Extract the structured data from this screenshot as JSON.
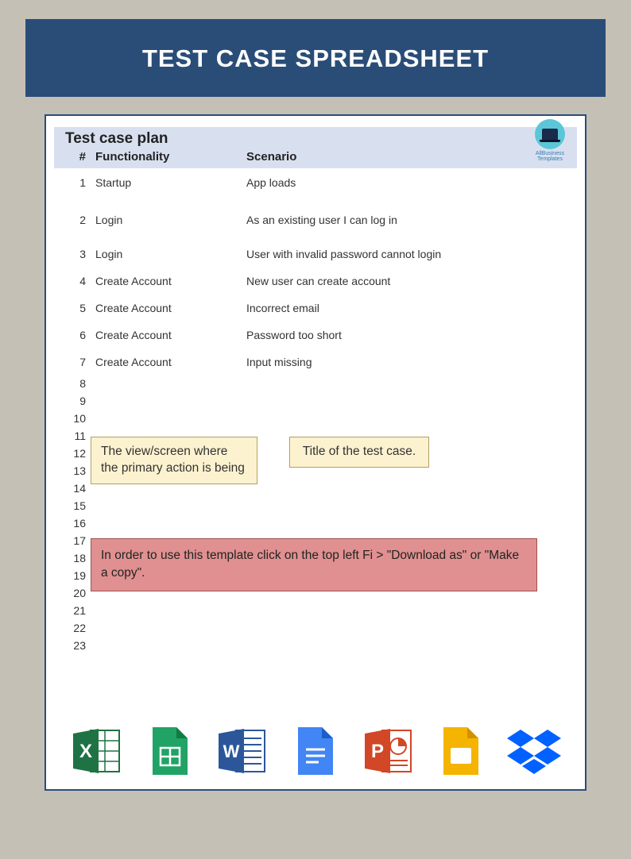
{
  "header": {
    "title": "TEST CASE SPREADSHEET"
  },
  "plan": {
    "title": "Test case plan",
    "columns": {
      "num": "#",
      "functionality": "Functionality",
      "scenario": "Scenario"
    },
    "rows": [
      {
        "num": "1",
        "functionality": "Startup",
        "scenario": "App loads"
      },
      {
        "num": "2",
        "functionality": "Login",
        "scenario": "As an existing user I can log in"
      },
      {
        "num": "3",
        "functionality": "Login",
        "scenario": "User with invalid password cannot login"
      },
      {
        "num": "4",
        "functionality": "Create Account",
        "scenario": "New user can create account"
      },
      {
        "num": "5",
        "functionality": "Create Account",
        "scenario": "Incorrect email"
      },
      {
        "num": "6",
        "functionality": "Create Account",
        "scenario": "Password too short"
      },
      {
        "num": "7",
        "functionality": "Create Account",
        "scenario": "Input missing"
      }
    ],
    "empty_rows": [
      "8",
      "9",
      "10",
      "11",
      "12",
      "13",
      "14",
      "15",
      "16",
      "17",
      "18",
      "19",
      "20",
      "21",
      "22",
      "23"
    ]
  },
  "logo": {
    "text": "AllBusiness Templates"
  },
  "notes": {
    "left": "The view/screen where the primary action is being",
    "right": "Title of the test case.",
    "instruction": "In order to use this template click on the top left Fi > \"Download as\" or \"Make a copy\"."
  },
  "icons": {
    "excel": "excel-icon",
    "sheets": "google-sheets-icon",
    "word": "word-icon",
    "docs": "google-docs-icon",
    "powerpoint": "powerpoint-icon",
    "slides": "google-slides-icon",
    "dropbox": "dropbox-icon"
  }
}
